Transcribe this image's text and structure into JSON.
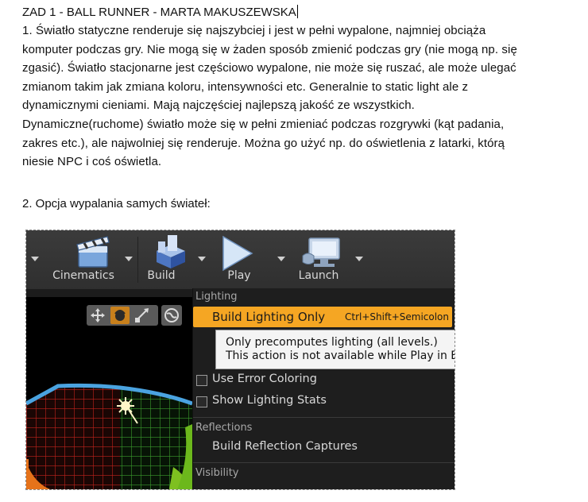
{
  "document": {
    "title": "ZAD 1 - BALL RUNNER - MARTA MAKUSZEWSKA",
    "paragraph1_lines": [
      "1. Światło statyczne renderuje  się najszybciej  i jest w pełni  wypalone, najmniej  obciąża",
      "komputer  podczas gry.  Nie mogą się w żaden  sposób zmienić  podczas gry (nie mogą np. się",
      "zgasić). Światło stacjonarne jest częściowo wypalone, nie może się ruszać, ale może ulegać",
      "zmianom takim jak zmiana koloru, intensywności  etc. Generalnie  to static light ale z",
      "dynamicznymi  cieniami.  Mają najczęściej najlepszą jakość ze wszystkich.",
      "Dynamiczne(ruchome)  światło może się w pełni zmieniać podczas rozgrywki (kąt padania,",
      "zakres etc.), ale najwolniej  się renderuje.  Można go użyć np. do oświetlenia z latarki, którą",
      "niesie  NPC i coś oświetla."
    ],
    "paragraph2": "2. Opcja wypalania samych świateł:"
  },
  "screenshot": {
    "toolbar": {
      "cinematics": "Cinematics",
      "build": "Build",
      "play": "Play",
      "launch": "Launch"
    },
    "menu": {
      "lighting_header": "Lighting",
      "build_lighting_only": "Build Lighting Only",
      "build_lighting_shortcut": "Ctrl+Shift+Semicolon",
      "tooltip_line1": "Only precomputes lighting (all levels.)",
      "tooltip_line2": "This action is not available while Play in E",
      "use_error_coloring": "Use Error Coloring",
      "show_lighting_stats": "Show Lighting Stats",
      "reflections_header": "Reflections",
      "build_reflection_captures": "Build Reflection Captures",
      "visibility_header": "Visibility"
    },
    "colors": {
      "accent": "#f5a623",
      "menu_bg": "#1e1e1e",
      "toolbar_bg": "#353535",
      "tooltip_bg": "#f4f4f4"
    }
  }
}
